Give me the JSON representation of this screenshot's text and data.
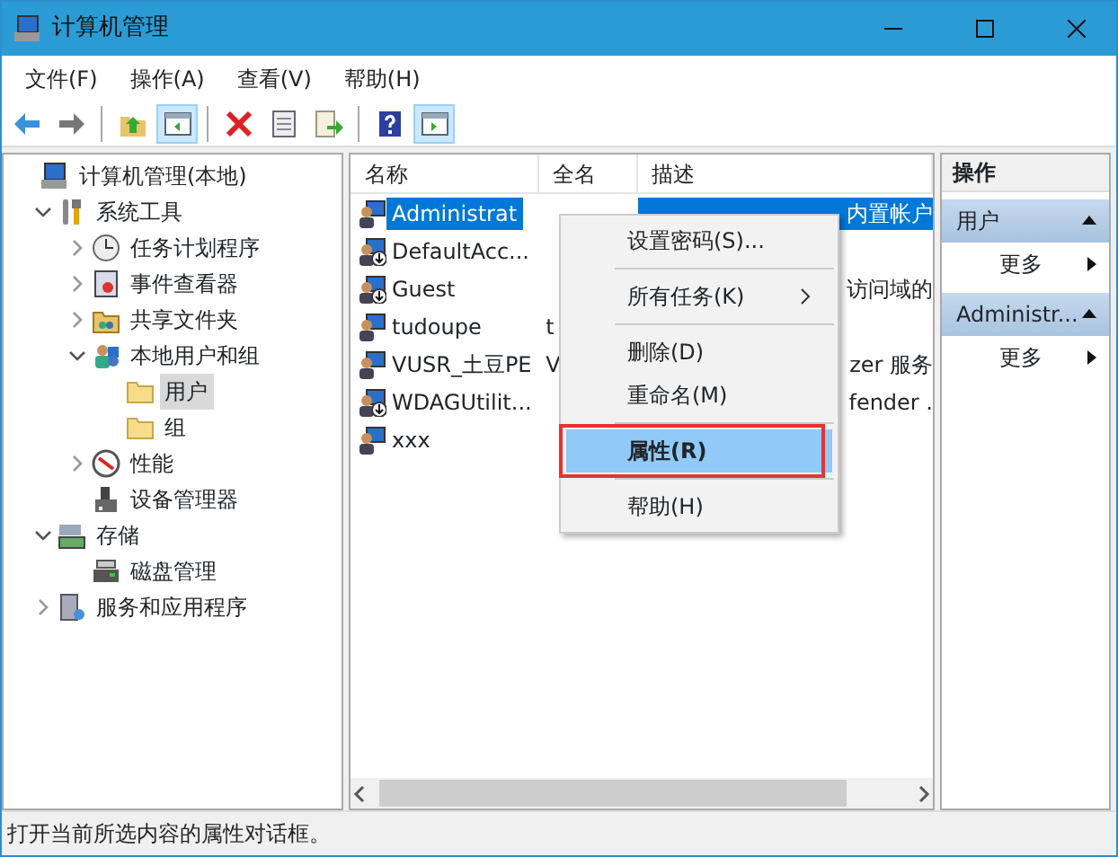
{
  "window": {
    "title": "计算机管理"
  },
  "menu_bar": [
    "文件(F)",
    "操作(A)",
    "查看(V)",
    "帮助(H)"
  ],
  "toolbar": [
    {
      "kind": "back",
      "pressed": false
    },
    {
      "kind": "forward",
      "pressed": false
    },
    {
      "kind": "sep"
    },
    {
      "kind": "up",
      "pressed": false
    },
    {
      "kind": "pane",
      "pressed": true
    },
    {
      "kind": "sep"
    },
    {
      "kind": "delete",
      "pressed": false
    },
    {
      "kind": "props",
      "pressed": false
    },
    {
      "kind": "export",
      "pressed": false
    },
    {
      "kind": "sep"
    },
    {
      "kind": "help",
      "pressed": false
    },
    {
      "kind": "pane2",
      "pressed": true
    }
  ],
  "tree": [
    {
      "label": "计算机管理(本地)",
      "kind": "computer",
      "selected": false,
      "children": [
        {
          "label": "系统工具",
          "kind": "tools",
          "expanded": true,
          "selected": false,
          "children": [
            {
              "label": "任务计划程序",
              "kind": "clock",
              "expanded": false,
              "selected": false
            },
            {
              "label": "事件查看器",
              "kind": "log",
              "expanded": false,
              "selected": false
            },
            {
              "label": "共享文件夹",
              "kind": "share",
              "expanded": false,
              "selected": false
            },
            {
              "label": "本地用户和组",
              "kind": "users",
              "expanded": true,
              "selected": false,
              "children": [
                {
                  "label": "用户",
                  "kind": "folder",
                  "selected": true
                },
                {
                  "label": "组",
                  "kind": "folder",
                  "selected": false
                }
              ]
            },
            {
              "label": "性能",
              "kind": "perf",
              "expanded": false,
              "selected": false
            },
            {
              "label": "设备管理器",
              "kind": "device",
              "selected": false
            }
          ]
        },
        {
          "label": "存储",
          "kind": "storage",
          "expanded": true,
          "selected": false,
          "children": [
            {
              "label": "磁盘管理",
              "kind": "disk",
              "selected": false
            }
          ]
        },
        {
          "label": "服务和应用程序",
          "kind": "services",
          "expanded": false,
          "selected": false
        }
      ]
    }
  ],
  "table": {
    "columns": [
      "名称",
      "全名",
      "描述"
    ],
    "rows": [
      {
        "name": "Administrat",
        "description": "内置帐户",
        "selected": true,
        "disabled": false
      },
      {
        "name": "DefaultAcc...",
        "selected": false,
        "disabled": true
      },
      {
        "name": "Guest",
        "description": "访问域的",
        "selected": false,
        "disabled": true
      },
      {
        "name": "tudoupe",
        "full_name": "t",
        "selected": false,
        "disabled": false
      },
      {
        "name": "VUSR_土豆PE",
        "full_name": "V",
        "description": "zer 服务",
        "selected": false,
        "disabled": false
      },
      {
        "name": "WDAGUtilit...",
        "description": "fender .",
        "selected": false,
        "disabled": true
      },
      {
        "name": "xxx",
        "selected": false,
        "disabled": false
      }
    ]
  },
  "context_menu": [
    {
      "kind": "item",
      "label": "设置密码(S)...",
      "submenu": false,
      "selected": false,
      "annotated": false
    },
    {
      "kind": "separator"
    },
    {
      "kind": "item",
      "label": "所有任务(K)",
      "submenu": true,
      "selected": false,
      "annotated": false
    },
    {
      "kind": "separator"
    },
    {
      "kind": "item",
      "label": "删除(D)",
      "submenu": false,
      "selected": false,
      "annotated": false
    },
    {
      "kind": "item",
      "label": "重命名(M)",
      "submenu": false,
      "selected": false,
      "annotated": false
    },
    {
      "kind": "separator"
    },
    {
      "kind": "item",
      "label": "属性(R)",
      "submenu": false,
      "selected": true,
      "annotated": true
    },
    {
      "kind": "separator"
    },
    {
      "kind": "item",
      "label": "帮助(H)",
      "submenu": false,
      "selected": false,
      "annotated": false
    }
  ],
  "actions": {
    "title": "操作",
    "sections": [
      {
        "title": "用户",
        "items": [
          "更多"
        ]
      },
      {
        "title": "Administr...",
        "items": [
          "更多"
        ]
      }
    ]
  },
  "status_bar": {
    "text": "打开当前所选内容的属性对话框。"
  }
}
